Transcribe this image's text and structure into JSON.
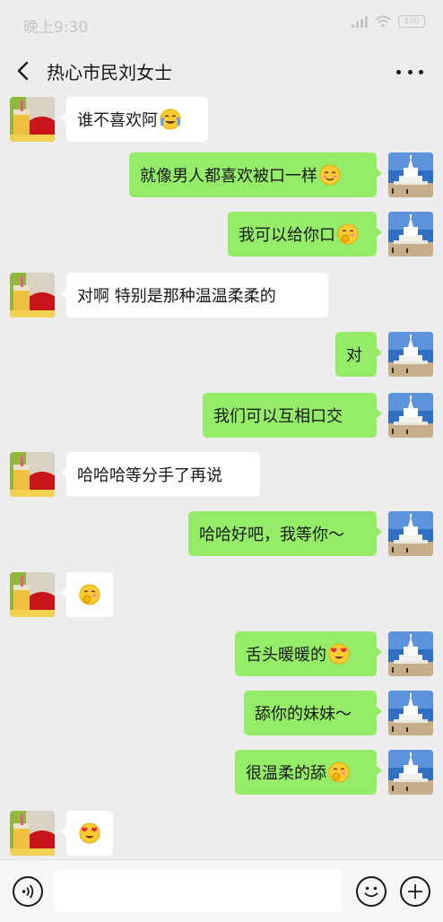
{
  "status_bar": {
    "time": "晚上9:30",
    "battery": "100"
  },
  "header": {
    "title": "热心市民刘女士"
  },
  "colors": {
    "sent_bubble": "#95ec69",
    "received_bubble": "#ffffff",
    "background": "#ededed"
  },
  "messages": [
    {
      "side": "left",
      "text": "谁不喜欢阿",
      "emoji": "crying-laughing-emoji"
    },
    {
      "side": "right",
      "text": "就像男人都喜欢被口一样",
      "emoji": "blushing-smile-emoji"
    },
    {
      "side": "right",
      "text": "我可以给你口",
      "emoji": "shy-face-emoji"
    },
    {
      "side": "left",
      "text": "对啊  特别是那种温温柔柔的",
      "emoji": ""
    },
    {
      "side": "right",
      "text": "对",
      "emoji": ""
    },
    {
      "side": "right",
      "text": "我们可以互相口交",
      "emoji": ""
    },
    {
      "side": "left",
      "text": "哈哈哈等分手了再说",
      "emoji": ""
    },
    {
      "side": "right",
      "text": "哈哈好吧，我等你～",
      "emoji": ""
    },
    {
      "side": "left",
      "text": "",
      "emoji": "shy-face-emoji"
    },
    {
      "side": "right",
      "text": "舌头暖暖的",
      "emoji": "heart-eyes-emoji"
    },
    {
      "side": "right",
      "text": "舔你的妹妹～",
      "emoji": ""
    },
    {
      "side": "right",
      "text": "很温柔的舔",
      "emoji": "shy-face-emoji"
    },
    {
      "side": "left",
      "text": "",
      "emoji": "heart-eyes-emoji"
    }
  ],
  "input": {
    "value": "",
    "placeholder": ""
  }
}
